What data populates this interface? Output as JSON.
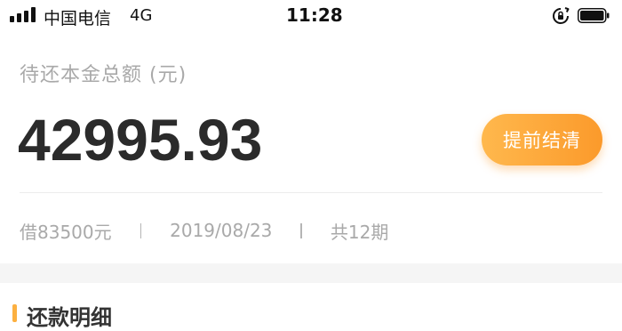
{
  "status_bar": {
    "carrier": "中国电信",
    "network": "4G",
    "time": "11:28",
    "icons": [
      "signal-icon",
      "rotation-lock-icon",
      "battery-icon"
    ]
  },
  "summary": {
    "label": "待还本金总额 (元)",
    "amount": "42995.93",
    "prepay_button": "提前结清",
    "loan_amount": "借83500元",
    "loan_date": "2019/08/23",
    "installments": "共12期"
  },
  "next_section": {
    "title": "还款明细"
  },
  "colors": {
    "accent_start": "#ffb84d",
    "accent_end": "#fb9a2b",
    "amount_text": "#2b2b2b",
    "muted_text": "#a9a9a9",
    "section_bg": "#f5f5f5"
  }
}
